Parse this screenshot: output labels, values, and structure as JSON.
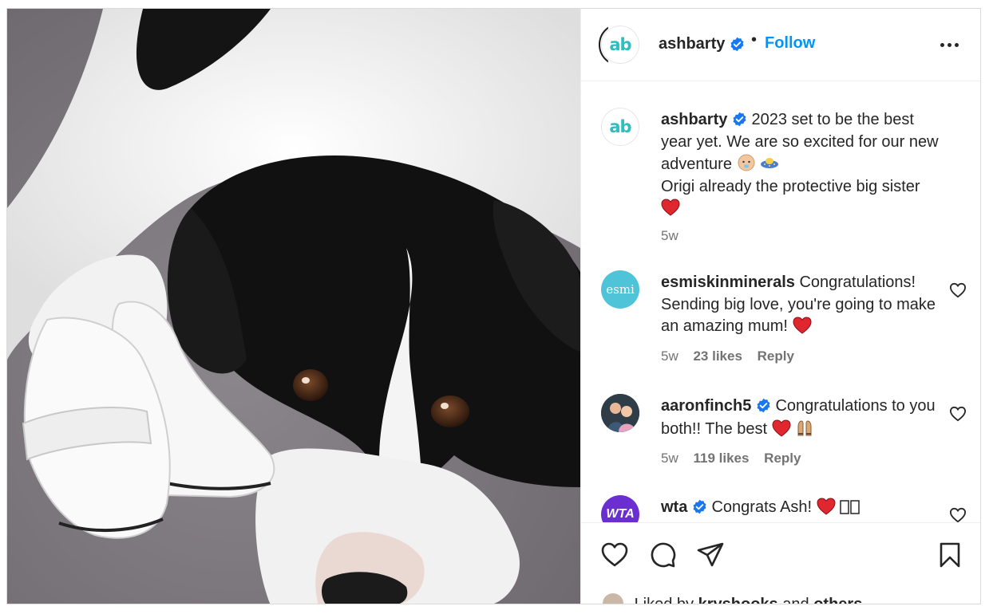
{
  "post": {
    "username": "ashbarty",
    "avatar_text": "ab",
    "follow_label": "Follow",
    "separator": "•"
  },
  "caption": {
    "username": "ashbarty",
    "text_line1": "2023 set to be the best year yet. We are so excited for our new adventure",
    "text_line2": "Origi already the protective big sister",
    "time": "5w"
  },
  "comments": [
    {
      "username": "esmiskinminerals",
      "avatar_text": "esmi",
      "text": "Congratulations! Sending big love, you're going to make an amazing mum!",
      "time": "5w",
      "likes": "23 likes",
      "reply": "Reply"
    },
    {
      "username": "aaronfinch5",
      "text": "Congratulations to you both!! The best",
      "time": "5w",
      "likes": "119 likes",
      "reply": "Reply"
    },
    {
      "username": "wta",
      "avatar_text": "WTA",
      "text": "Congrats Ash!"
    }
  ],
  "liked_by": {
    "prefix": "Liked by",
    "user": "kryshooks",
    "conj": "and",
    "others": "others"
  },
  "icons": {
    "like": "heart-icon",
    "comment": "comment-icon",
    "share": "send-icon",
    "save": "bookmark-icon",
    "more": "more-icon",
    "verified": "verified-icon"
  },
  "colors": {
    "accent": "#0095f6",
    "verified": "#1877f2",
    "heart": "#e0262e",
    "muted": "#737373"
  }
}
